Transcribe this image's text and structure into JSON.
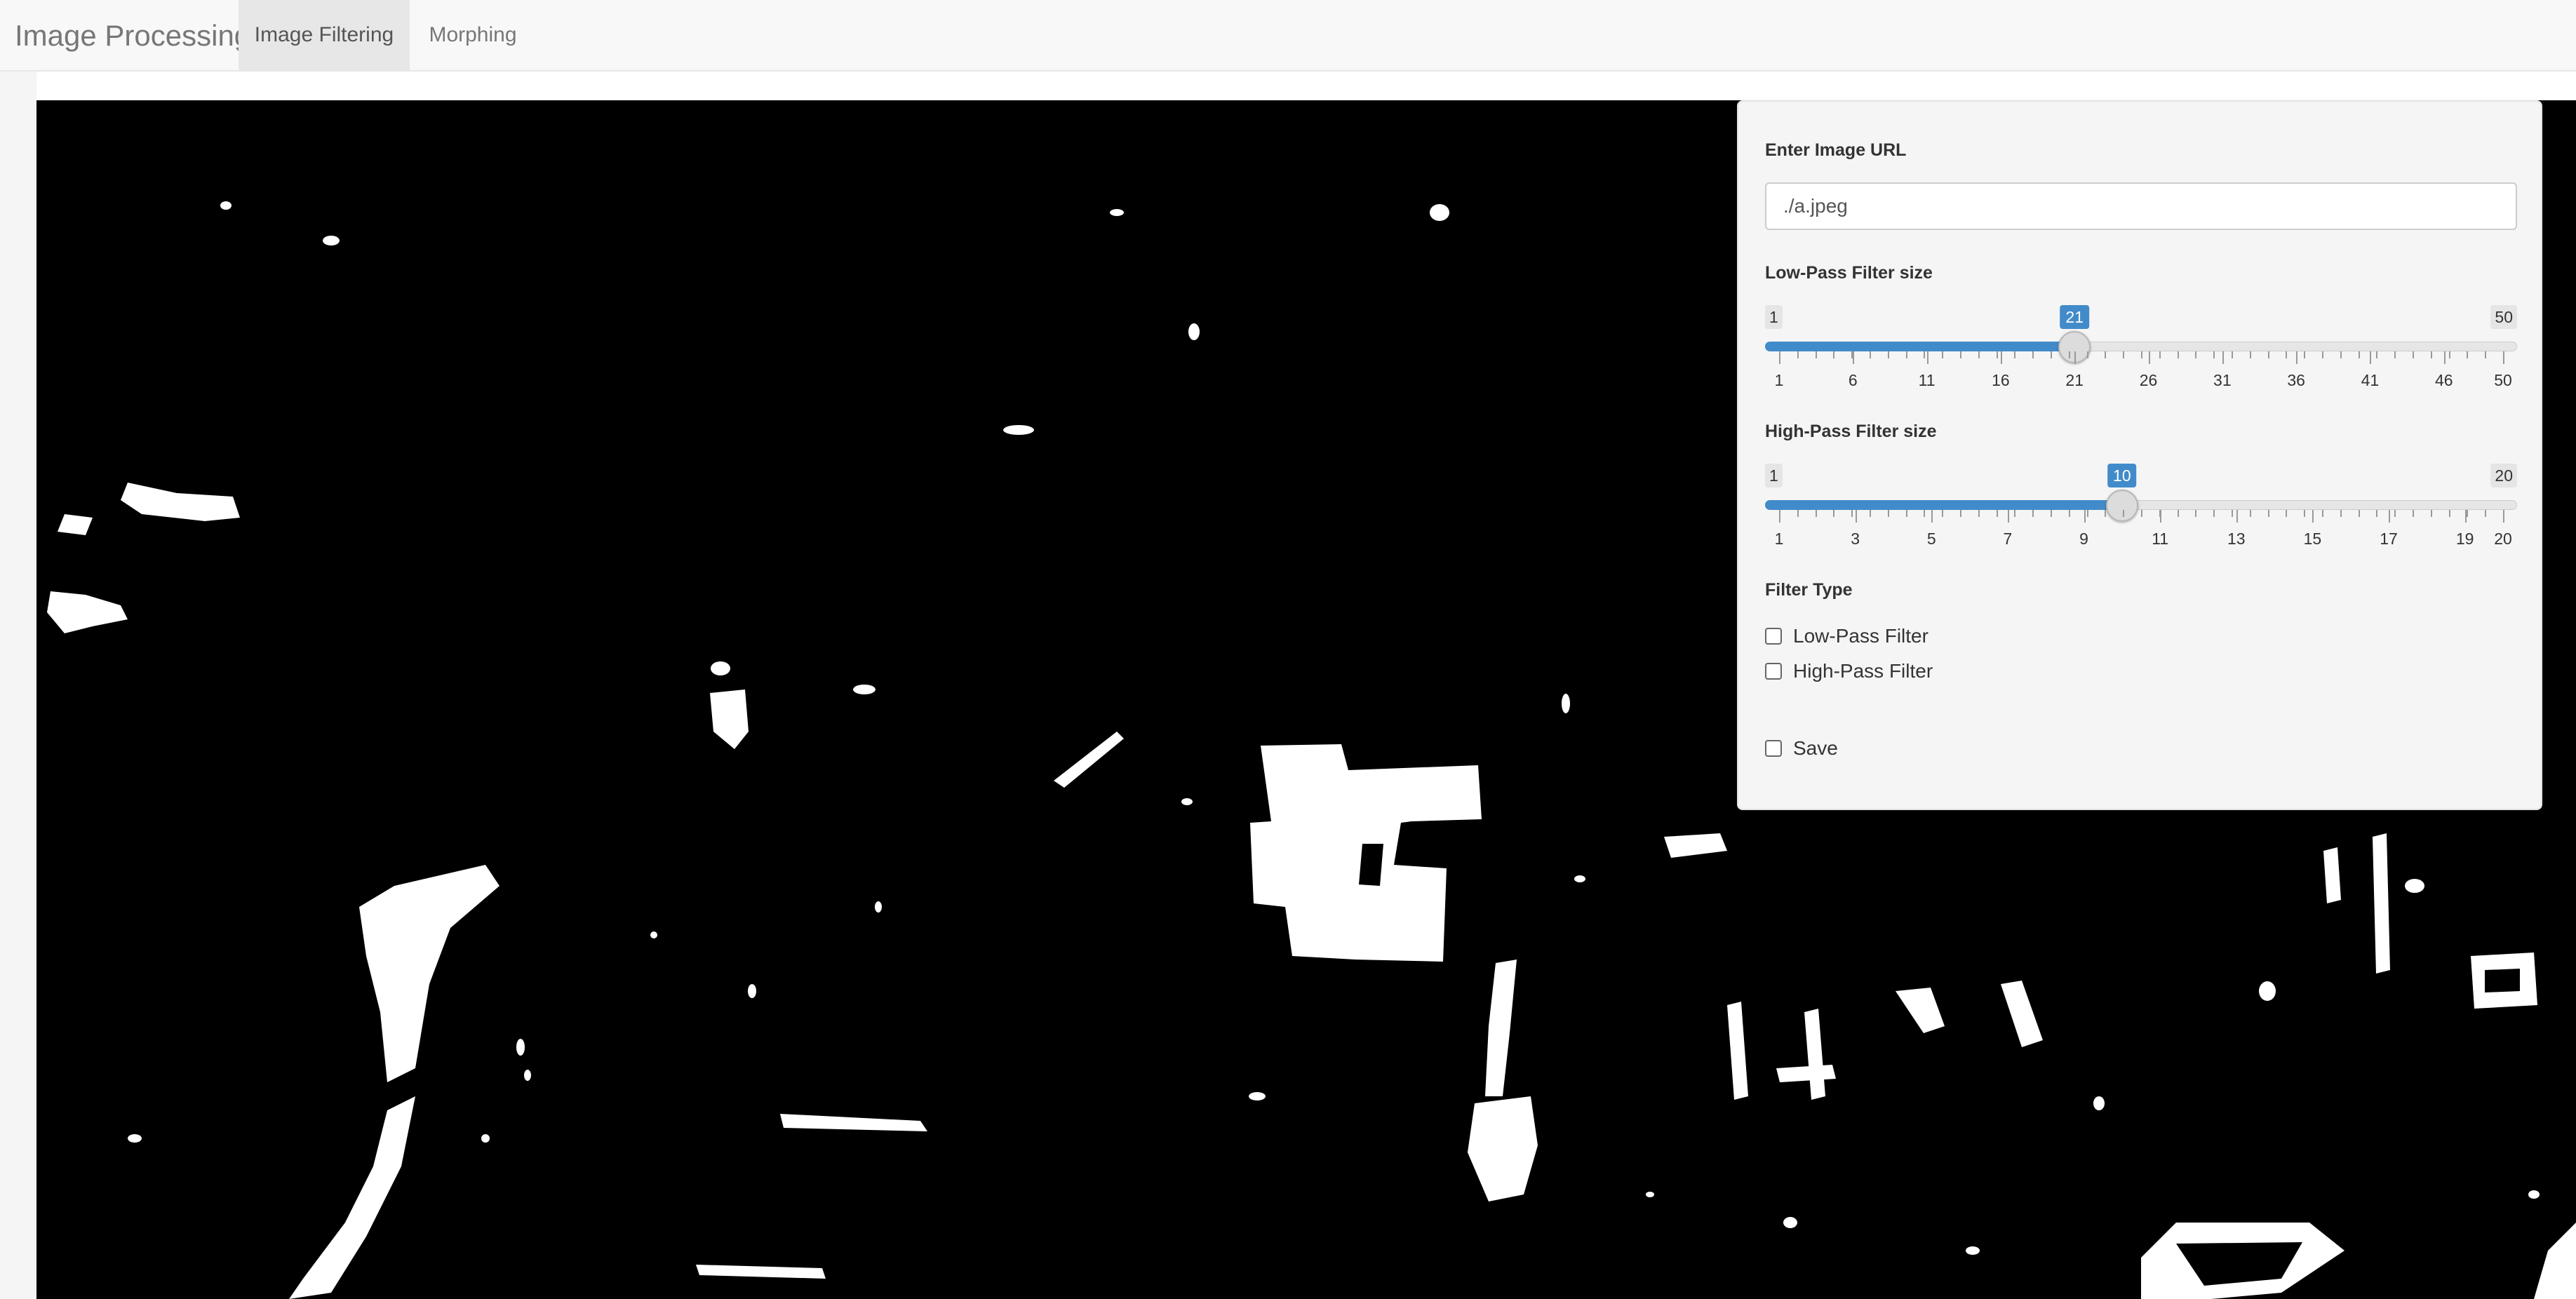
{
  "navbar": {
    "brand": "Image Processing",
    "tabs": [
      {
        "label": "Image Filtering",
        "active": true
      },
      {
        "label": "Morphing",
        "active": false
      }
    ]
  },
  "panel": {
    "url_label": "Enter Image URL",
    "url_value": "./a.jpeg",
    "low_pass": {
      "label": "Low-Pass Filter size",
      "min": 1,
      "max": 50,
      "value": 21,
      "min_label": "1",
      "max_label": "50",
      "value_label": "21",
      "tick_labels": [
        "1",
        "6",
        "11",
        "16",
        "21",
        "26",
        "31",
        "36",
        "41",
        "46",
        "50"
      ]
    },
    "high_pass": {
      "label": "High-Pass Filter size",
      "min": 1,
      "max": 20,
      "value": 10,
      "min_label": "1",
      "max_label": "20",
      "value_label": "10",
      "tick_labels": [
        "1",
        "3",
        "5",
        "7",
        "9",
        "11",
        "13",
        "15",
        "17",
        "19",
        "20"
      ]
    },
    "filter_type_label": "Filter Type",
    "checkboxes": {
      "low_pass": "Low-Pass Filter",
      "high_pass": "High-Pass Filter",
      "save": "Save"
    }
  },
  "colors": {
    "accent": "#428bca",
    "navbar_bg": "#f8f8f8",
    "panel_bg": "#f5f5f5",
    "image_bg": "#000000"
  }
}
